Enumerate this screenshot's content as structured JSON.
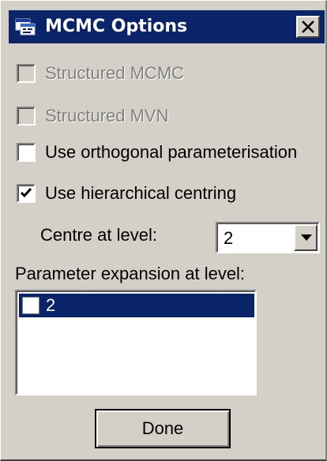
{
  "window": {
    "title": "MCMC Options",
    "app_icon": "mlwin-window-icon",
    "close_icon": "close-x-icon"
  },
  "options": [
    {
      "label": "Structured MCMC",
      "checked": false,
      "enabled": false
    },
    {
      "label": "Structured MVN",
      "checked": false,
      "enabled": false
    },
    {
      "label": "Use orthogonal parameterisation",
      "checked": false,
      "enabled": true
    },
    {
      "label": "Use hierarchical centring",
      "checked": true,
      "enabled": true
    }
  ],
  "centre_level": {
    "label": "Centre at level:",
    "selected": "2",
    "arrow_icon": "chevron-down-icon"
  },
  "param_expansion": {
    "label": "Parameter expansion at level:",
    "items": [
      {
        "label": "2",
        "checked": false,
        "selected": true
      }
    ]
  },
  "done_button": {
    "label": "Done"
  },
  "colors": {
    "titlebar": "#0a246a",
    "face": "#d4d0c8",
    "selection": "#0a246a",
    "disabled_text": "#808080"
  }
}
